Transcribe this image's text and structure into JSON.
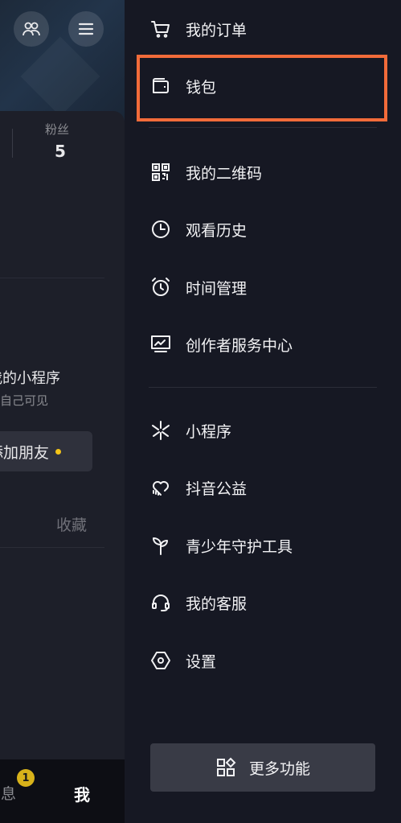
{
  "background_profile": {
    "stats": {
      "fans_label": "粉丝",
      "fans_value": "5"
    },
    "mini_program": {
      "title": "我的小程序",
      "subtitle": "仅自己可见"
    },
    "add_friend_label": "添加朋友",
    "favorites_tab": "收藏",
    "bottom_nav": {
      "messages_label": "消息",
      "messages_badge": "1",
      "me_label": "我"
    }
  },
  "drawer": {
    "items": [
      {
        "label": "我的订单",
        "icon": "cart-icon"
      },
      {
        "label": "钱包",
        "icon": "wallet-icon",
        "highlighted": true
      },
      {
        "label": "我的二维码",
        "icon": "qr-code-icon"
      },
      {
        "label": "观看历史",
        "icon": "clock-icon"
      },
      {
        "label": "时间管理",
        "icon": "alarm-clock-icon"
      },
      {
        "label": "创作者服务中心",
        "icon": "monitor-chart-icon"
      },
      {
        "label": "小程序",
        "icon": "mini-program-icon"
      },
      {
        "label": "抖音公益",
        "icon": "charity-heart-icon"
      },
      {
        "label": "青少年守护工具",
        "icon": "sprout-icon"
      },
      {
        "label": "我的客服",
        "icon": "headset-icon"
      },
      {
        "label": "设置",
        "icon": "settings-hexagon-icon"
      }
    ],
    "more_button_label": "更多功能"
  },
  "colors": {
    "highlight_border": "#f26b3a",
    "badge": "#d8b21a",
    "background": "#161823"
  }
}
